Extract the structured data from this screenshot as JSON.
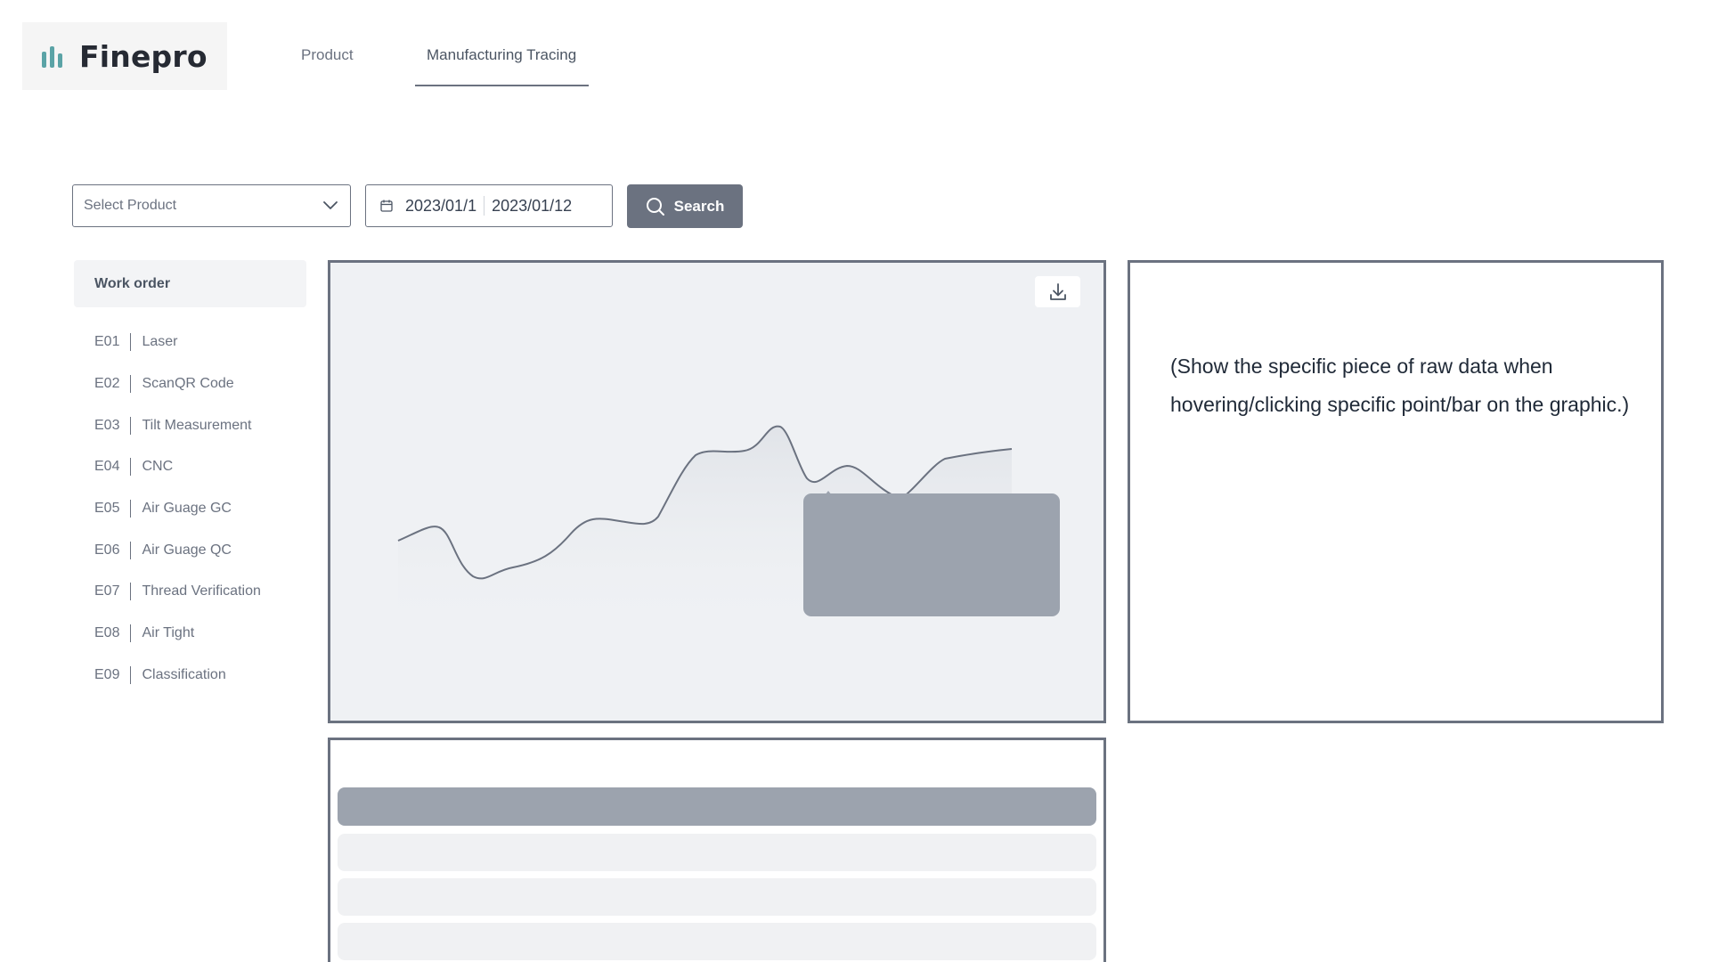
{
  "brand": {
    "name": "Finepro",
    "colors": {
      "accent": "#5ba3a6",
      "dark": "#262a33"
    }
  },
  "nav": {
    "tabs": [
      {
        "label": "Product",
        "active": false
      },
      {
        "label": "Manufacturing Tracing",
        "active": true
      }
    ]
  },
  "filters": {
    "product_placeholder": "Select Product",
    "date_start": "2023/01/1",
    "date_end": "2023/01/12",
    "search_label": "Search"
  },
  "sidebar": {
    "header": "Work order",
    "items": [
      {
        "code": "E01",
        "label": "Laser"
      },
      {
        "code": "E02",
        "label": "ScanQR Code"
      },
      {
        "code": "E03",
        "label": "Tilt Measurement"
      },
      {
        "code": "E04",
        "label": "CNC"
      },
      {
        "code": "E05",
        "label": "Air Guage GC"
      },
      {
        "code": "E06",
        "label": "Air Guage QC"
      },
      {
        "code": "E07",
        "label": "Thread Verification"
      },
      {
        "code": "E08",
        "label": "Air Tight"
      },
      {
        "code": "E09",
        "label": "Classification"
      }
    ]
  },
  "chart": {
    "download_icon": "download-icon",
    "tooltip_visible": true
  },
  "info": {
    "text": "(Show the specific piece of raw data when hovering/clicking specific point/bar on the graphic.)"
  },
  "table": {
    "visible_body_rows": 3
  }
}
